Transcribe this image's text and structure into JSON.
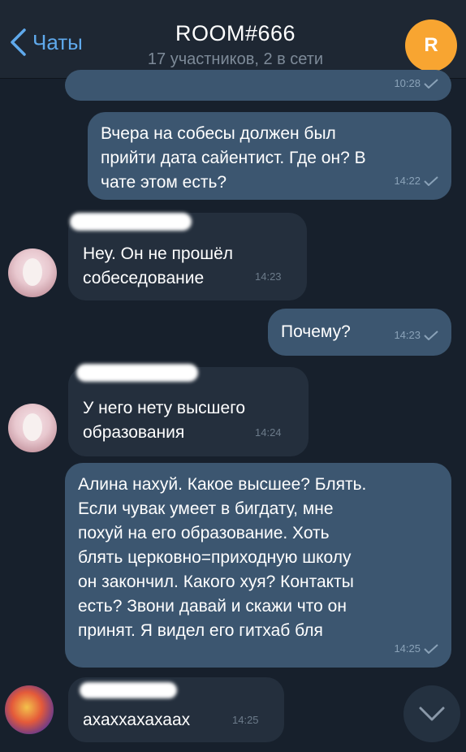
{
  "header": {
    "back_label": "Чаты",
    "title": "ROOM#666",
    "subtitle": "17 участников, 2 в сети",
    "avatar_letter": "R",
    "avatar_color": "#f8a531"
  },
  "messages": [
    {
      "direction": "out",
      "text": "",
      "time": "10:28",
      "read": true
    },
    {
      "direction": "out",
      "text": "Вчера на собесы должен был\nприйти дата сайентист. Где он? В\nчате этом есть?",
      "time": "14:22",
      "read": true
    },
    {
      "direction": "in",
      "text": "Неу. Он не прошёл\nсобеседование",
      "time": "14:23"
    },
    {
      "direction": "out",
      "text": "Почему?",
      "time": "14:23",
      "read": true
    },
    {
      "direction": "in",
      "text": "У него нету высшего\nобразования",
      "time": "14:24"
    },
    {
      "direction": "out",
      "text": "Алина нахуй. Какое высшее? Блять.\nЕсли чувак умеет в бигдату, мне\nпохуй на его образование. Хоть\nблять церковно=приходную школу\nон закончил.  Какого хуя? Контакты\nесть? Звони давай и скажи что он\nпринят. Я  видел его гитхаб бля",
      "time": "14:25",
      "read": true
    },
    {
      "direction": "in",
      "text": "ахаххахахаах",
      "time": "14:25"
    }
  ],
  "colors": {
    "background": "#17202c",
    "outgoing_bubble": "#3c5670",
    "incoming_bubble": "#242f3d",
    "accent": "#5fa9ec"
  }
}
